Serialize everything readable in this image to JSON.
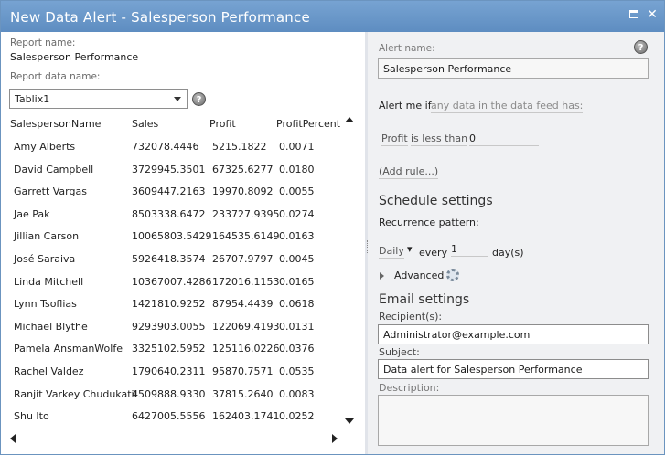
{
  "window": {
    "title": "New Data Alert - Salesperson Performance"
  },
  "left": {
    "report_name_label": "Report name:",
    "report_name_value": "Salesperson Performance",
    "report_data_label": "Report data name:",
    "report_data_selected": "Tablix1",
    "columns": [
      "SalespersonName",
      "Sales",
      "Profit",
      "ProfitPercent"
    ],
    "rows": [
      [
        "Amy Alberts",
        "732078.4446",
        "5215.1822",
        "0.0071"
      ],
      [
        "David Campbell",
        "3729945.3501",
        "67325.6277",
        "0.0180"
      ],
      [
        "Garrett Vargas",
        "3609447.2163",
        "19970.8092",
        "0.0055"
      ],
      [
        "Jae Pak",
        "8503338.6472",
        "233727.9395",
        "0.0274"
      ],
      [
        "Jillian Carson",
        "10065803.5429",
        "164535.6149",
        "0.0163"
      ],
      [
        "José Saraiva",
        "5926418.3574",
        "26707.9797",
        "0.0045"
      ],
      [
        "Linda Mitchell",
        "10367007.4286",
        "172016.1153",
        "0.0165"
      ],
      [
        "Lynn Tsoflias",
        "1421810.9252",
        "87954.4439",
        "0.0618"
      ],
      [
        "Michael Blythe",
        "9293903.0055",
        "122069.4193",
        "0.0131"
      ],
      [
        "Pamela AnsmanWolfe",
        "3325102.5952",
        "125116.0226",
        "0.0376"
      ],
      [
        "Rachel Valdez",
        "1790640.2311",
        "95870.7571",
        "0.0535"
      ],
      [
        "Ranjit Varkey Chudukatil",
        "4509888.9330",
        "37815.2640",
        "0.0083"
      ],
      [
        "Shu Ito",
        "6427005.5556",
        "162403.1741",
        "0.0252"
      ]
    ]
  },
  "right": {
    "alert_name_label": "Alert name:",
    "alert_name_value": "Salesperson Performance",
    "alert_me_if": "Alert me if",
    "alert_condition": "any data in the data feed has:",
    "rule_field": "Profit",
    "rule_operator": "is less than",
    "rule_value": "0",
    "add_rule": "(Add rule...)",
    "schedule_heading": "Schedule settings",
    "recurrence_label": "Recurrence pattern:",
    "recurrence_unit": "Daily",
    "every_label": "every",
    "every_value": "1",
    "days_label": "day(s)",
    "advanced_label": "Advanced",
    "email_heading": "Email settings",
    "recipients_label": "Recipient(s):",
    "recipients_value": "Administrator@example.com",
    "subject_label": "Subject:",
    "subject_value": "Data alert for Salesperson Performance",
    "description_label": "Description:"
  },
  "colors": {
    "titlebar": "#6a97c9",
    "right_panel": "#f0f1f3"
  }
}
